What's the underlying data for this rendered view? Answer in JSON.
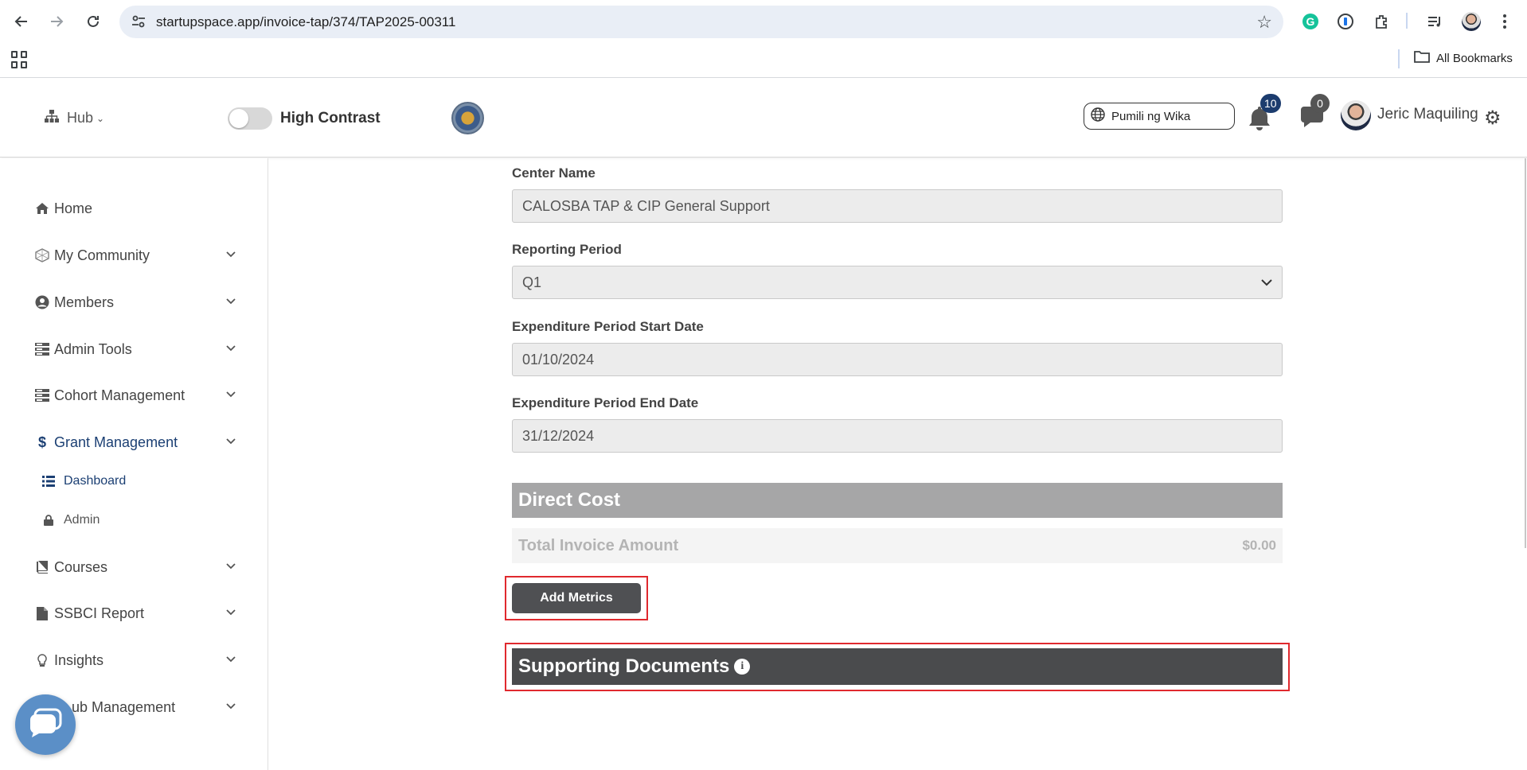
{
  "browser": {
    "url": "startupspace.app/invoice-tap/374/TAP2025-00311",
    "all_bookmarks_label": "All Bookmarks",
    "icons": [
      "back-icon",
      "forward-icon",
      "reload-icon",
      "site-info-icon",
      "bookmark-star-icon",
      "grammarly-icon",
      "password-manager-icon",
      "extensions-icon",
      "media-icon",
      "profile-icon",
      "more-icon",
      "apps-icon",
      "folder-icon"
    ]
  },
  "header": {
    "hub_label": "Hub",
    "high_contrast_label": "High Contrast",
    "high_contrast_enabled": false,
    "language_label": "Pumili ng Wika",
    "notifications_count": "10",
    "messages_count": "0",
    "user_name": "Jeric Maquiling"
  },
  "sidebar": {
    "items": [
      {
        "label": "Home",
        "icon": "home-icon",
        "expandable": false
      },
      {
        "label": "My Community",
        "icon": "community-icon",
        "expandable": true
      },
      {
        "label": "Members",
        "icon": "user-circle-icon",
        "expandable": true
      },
      {
        "label": "Admin Tools",
        "icon": "server-icon",
        "expandable": true
      },
      {
        "label": "Cohort Management",
        "icon": "server-icon",
        "expandable": true
      },
      {
        "label": "Grant Management",
        "icon": "dollar-icon",
        "expandable": true,
        "active": true
      },
      {
        "label": "Courses",
        "icon": "book-icon",
        "expandable": true
      },
      {
        "label": "SSBCI Report",
        "icon": "file-icon",
        "expandable": true
      },
      {
        "label": "Insights",
        "icon": "lightbulb-icon",
        "expandable": true
      },
      {
        "label": "ub Management",
        "icon": "",
        "expandable": true
      }
    ],
    "grant_subitems": [
      {
        "label": "Dashboard",
        "icon": "list-icon",
        "active": true
      },
      {
        "label": "Admin",
        "icon": "lock-icon",
        "active": false
      }
    ]
  },
  "form": {
    "center_name_label": "Center Name",
    "center_name_value": "CALOSBA TAP & CIP General Support",
    "reporting_period_label": "Reporting Period",
    "reporting_period_value": "Q1",
    "start_date_label": "Expenditure Period Start Date",
    "start_date_value": "01/10/2024",
    "end_date_label": "Expenditure Period End Date",
    "end_date_value": "31/12/2024",
    "direct_cost_title": "Direct Cost",
    "total_invoice_label": "Total Invoice Amount",
    "total_invoice_value": "$0.00",
    "add_metrics_label": "Add Metrics",
    "supporting_documents_title": "Supporting Documents"
  },
  "colors": {
    "brand_navy": "#1b3f73",
    "highlight_red": "#e0292e",
    "direct_cost_bar": "#a6a6a7",
    "supporting_bar": "#4a4b4d"
  }
}
